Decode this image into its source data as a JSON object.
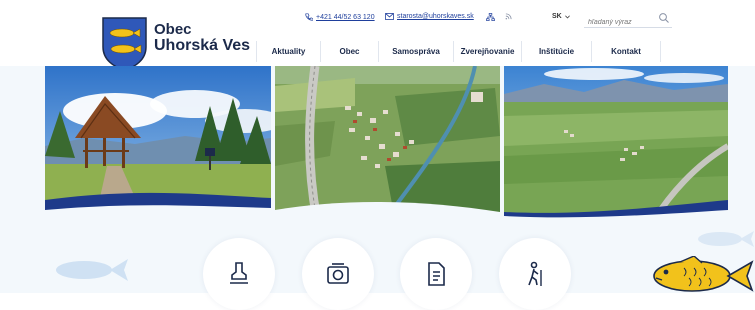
{
  "site": {
    "name_line1": "Obec",
    "name_line2": "Uhorská Ves",
    "logo_icon": "coat-of-arms-fish"
  },
  "topbar": {
    "phone": "+421 44/52 63 120",
    "email": "starosta@uhorskaves.sk",
    "sitemap_icon": "sitemap-icon",
    "rss_icon": "rss-icon",
    "language": "SK",
    "search_placeholder": "hľadaný výraz"
  },
  "nav": {
    "items": [
      {
        "label": "Aktuality"
      },
      {
        "label": "Obec"
      },
      {
        "label": "Samospráva"
      },
      {
        "label": "Zverejňovanie"
      },
      {
        "label": "Inštitúcie"
      },
      {
        "label": "Kontakt"
      }
    ]
  },
  "banner": {
    "photos": [
      "wooden-gazebo-park",
      "aerial-village-highway",
      "aerial-valley-mountains"
    ]
  },
  "services": [
    {
      "icon": "stamp-icon"
    },
    {
      "icon": "camera-icon"
    },
    {
      "icon": "document-icon"
    },
    {
      "icon": "hiker-icon"
    }
  ],
  "colors": {
    "brand_dark": "#1c2a4a",
    "link_blue": "#1f3f9c",
    "wave_navy": "#1e3a8a",
    "fish_yellow": "#f2c21b",
    "ghost_fish": "#cfe1f3"
  }
}
